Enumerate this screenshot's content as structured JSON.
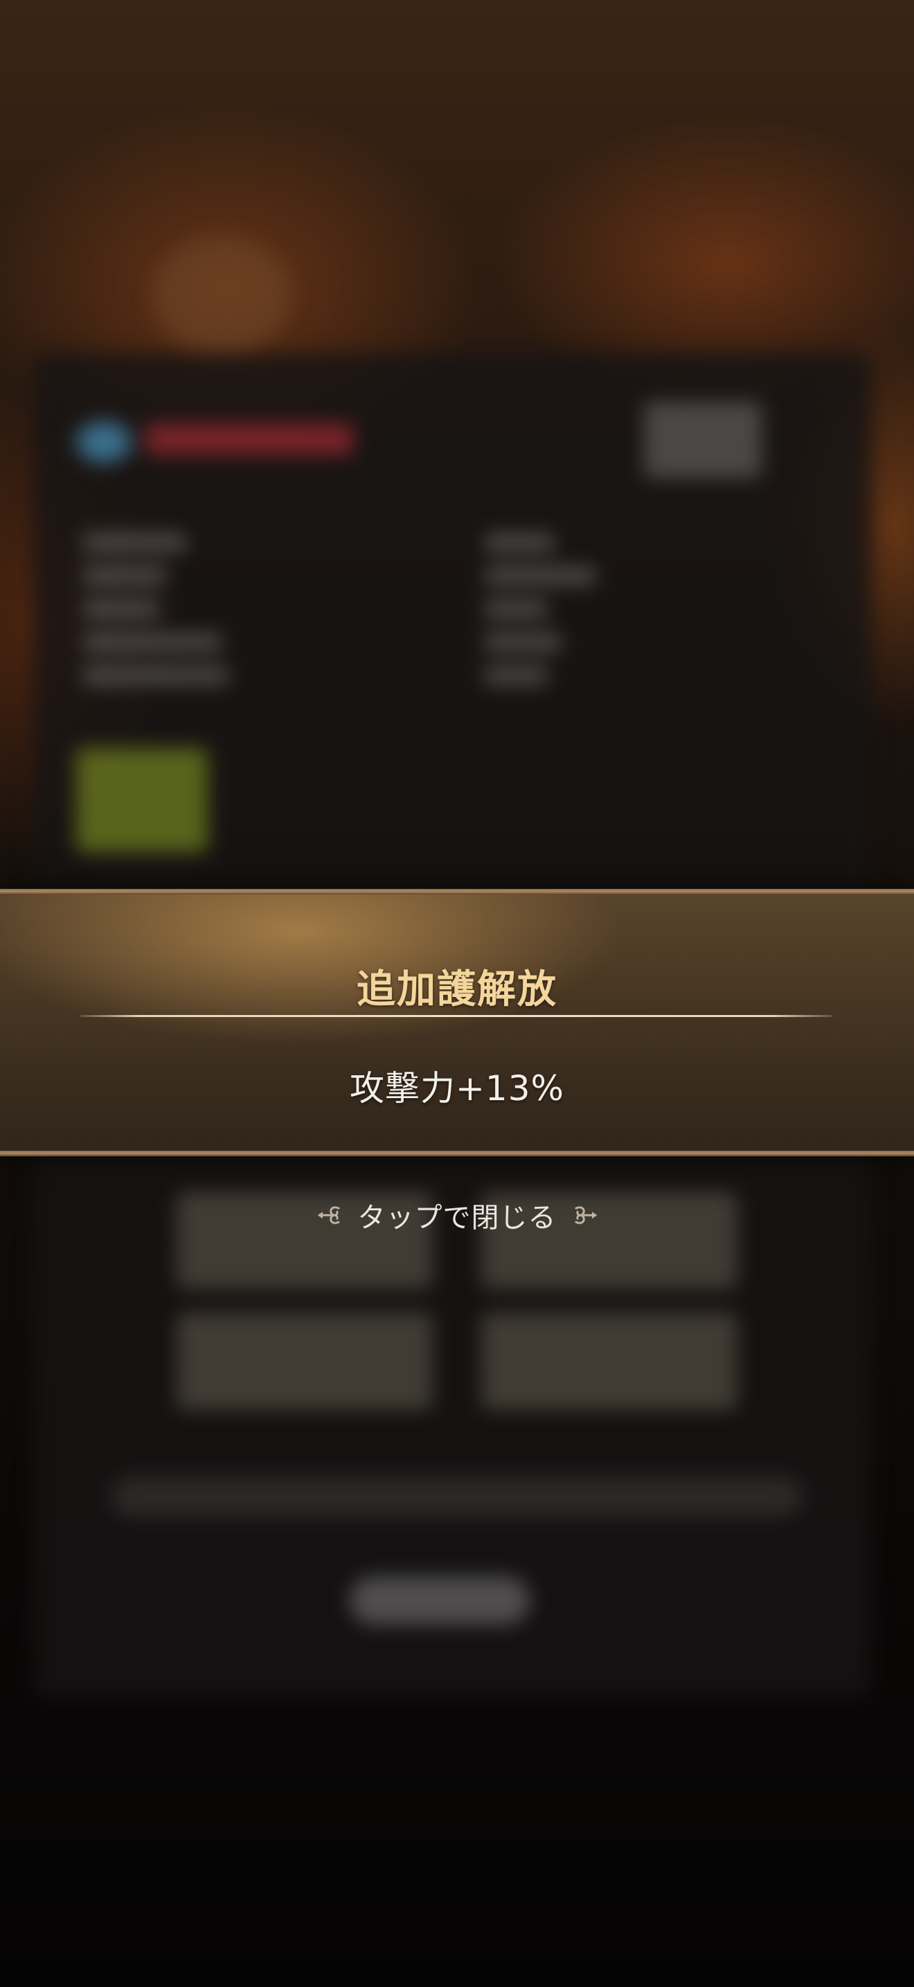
{
  "overlay": {
    "title": "追加護解放",
    "effect": "攻撃力+13%",
    "close_hint": "タップで閉じる"
  },
  "icons": {
    "left_ornament": "scroll-ornament-left-icon",
    "right_ornament": "scroll-ornament-right-icon"
  },
  "colors": {
    "title": "#f4d59b",
    "effect_text": "#f3efe9",
    "banner_base": "#4a3824",
    "banner_edge": "#b08a62"
  }
}
